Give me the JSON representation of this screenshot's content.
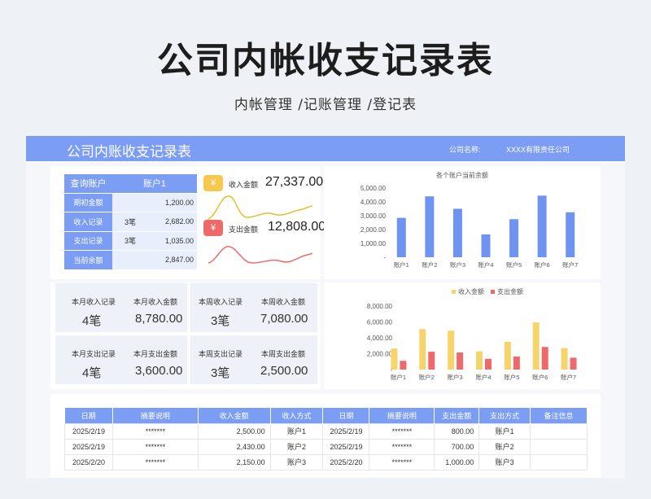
{
  "hero": {
    "title": "公司内帐收支记录表",
    "subtitle": "内帐管理 /记账管理 /登记表"
  },
  "topbar": {
    "title": "公司内账收支记录表",
    "company_label": "公司名称:",
    "company_value": "XXXX有限责任公司"
  },
  "account": {
    "header_label": "查询账户",
    "header_value": "账户1",
    "rows": [
      {
        "label": "期初金额",
        "count": "",
        "amount": "1,200.00"
      },
      {
        "label": "收入记录",
        "count": "3笔",
        "amount": "2,682.00"
      },
      {
        "label": "支出记录",
        "count": "3笔",
        "amount": "1,035.00"
      },
      {
        "label": "当前余额",
        "count": "",
        "amount": "2,847.00"
      }
    ]
  },
  "kpi": {
    "income_icon": "¥",
    "income_label": "收入金额",
    "income_value": "27,337.00",
    "expense_icon": "¥",
    "expense_label": "支出金额",
    "expense_value": "12,808.00",
    "income_color": "#f6c94e",
    "expense_color": "#ee6a6a"
  },
  "stats": [
    {
      "l1": "本月收入记录",
      "v1": "4笔",
      "l2": "本月收入金额",
      "v2": "8,780.00"
    },
    {
      "l1": "本周收入记录",
      "v1": "3笔",
      "l2": "本周收入金额",
      "v2": "7,080.00"
    },
    {
      "l1": "本月支出记录",
      "v1": "4笔",
      "l2": "本月支出金额",
      "v2": "3,600.00"
    },
    {
      "l1": "本周支出记录",
      "v1": "3笔",
      "l2": "本周支出金额",
      "v2": "2,500.00"
    }
  ],
  "chart_data": [
    {
      "type": "bar",
      "title": "各个账户当前余额",
      "categories": [
        "账户1",
        "账户2",
        "账户3",
        "账户4",
        "账户5",
        "账户6",
        "账户7"
      ],
      "values": [
        2847,
        4400,
        3500,
        1650,
        2750,
        4450,
        3250
      ],
      "ylim": [
        0,
        5000
      ],
      "yticks": [
        "-",
        "1,000.00",
        "2,000.00",
        "3,000.00",
        "4,000.00",
        "5,000.00"
      ],
      "color": "#6f93f0"
    },
    {
      "type": "bar",
      "title": "",
      "categories": [
        "账户1",
        "账户2",
        "账户3",
        "账户4",
        "账户5",
        "账户6",
        "账户7"
      ],
      "series": [
        {
          "name": "收入金额",
          "values": [
            2650,
            5100,
            4900,
            2300,
            3500,
            5950,
            2700
          ],
          "color": "#f6d36b"
        },
        {
          "name": "支出金额",
          "values": [
            1100,
            2250,
            2150,
            1350,
            1650,
            2850,
            1500
          ],
          "color": "#ee6a6a"
        }
      ],
      "ylim": [
        0,
        8000
      ],
      "yticks": [
        "-",
        "2,000.00",
        "4,000.00",
        "6,000.00",
        "8,000.00"
      ],
      "legend": "top"
    }
  ],
  "table": {
    "headers": [
      "日期",
      "摘要说明",
      "收入金额",
      "收入方式",
      "日期",
      "摘要说明",
      "支出金额",
      "支出方式",
      "备注信息"
    ],
    "rows": [
      [
        "2025/2/19",
        "*******",
        "2,500.00",
        "账户1",
        "2025/2/19",
        "*******",
        "800.00",
        "账户1",
        ""
      ],
      [
        "2025/2/19",
        "*******",
        "2,430.00",
        "账户2",
        "2025/2/19",
        "*******",
        "700.00",
        "账户2",
        ""
      ],
      [
        "2025/2/20",
        "*******",
        "2,150.00",
        "账户3",
        "2025/2/20",
        "*******",
        "1,000.00",
        "账户3",
        ""
      ]
    ]
  }
}
